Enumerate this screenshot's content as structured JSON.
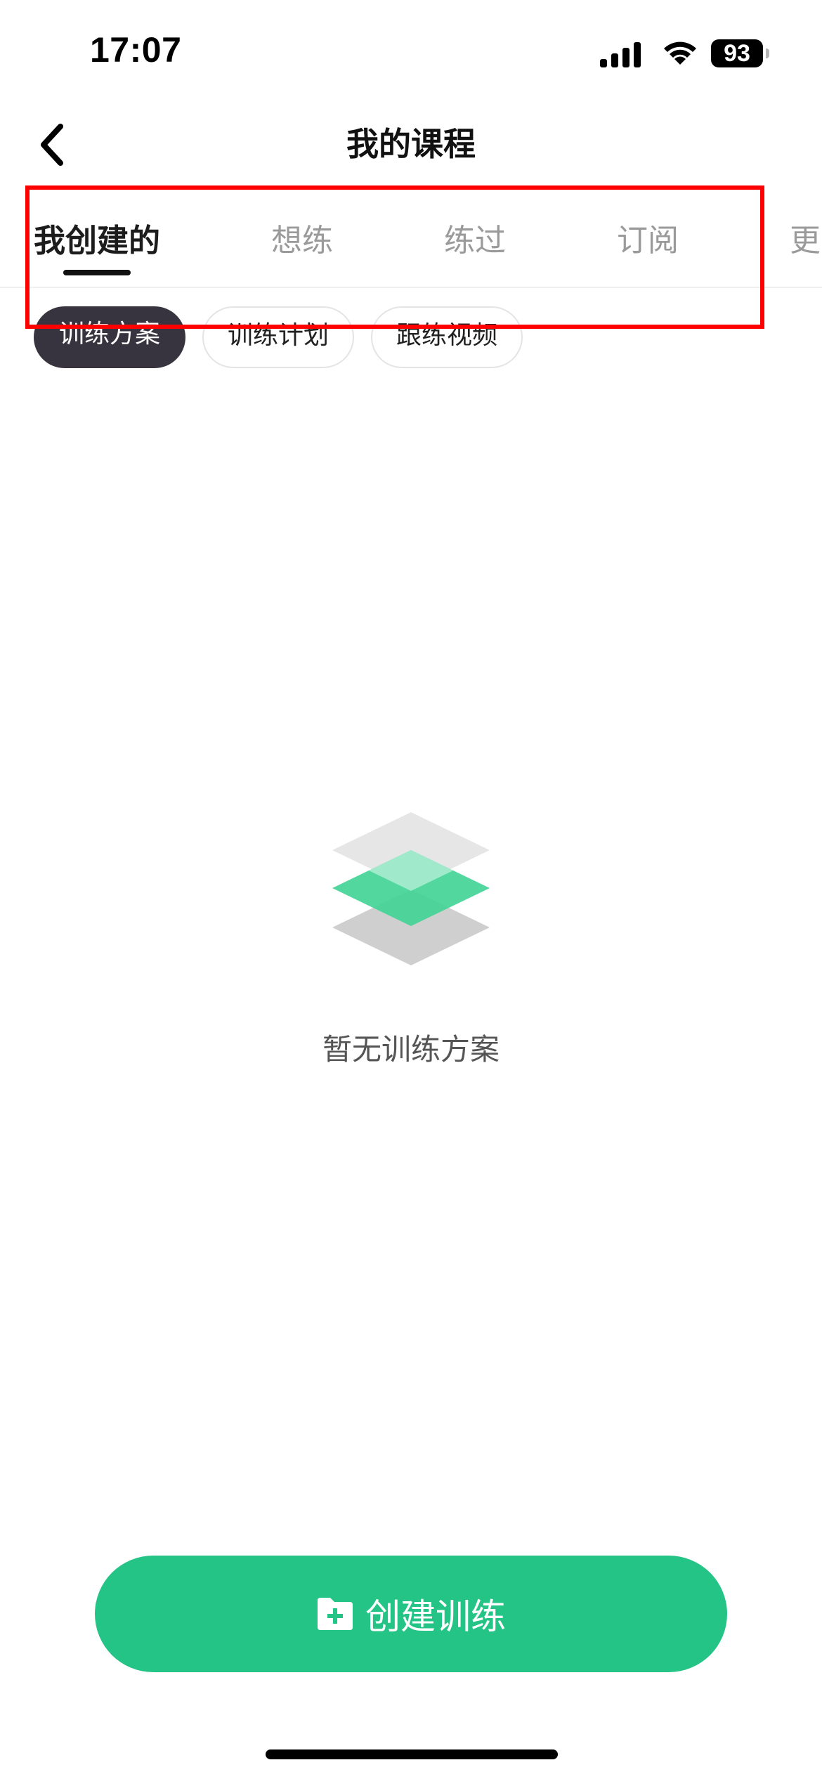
{
  "status_bar": {
    "time": "17:07",
    "battery_level": "93",
    "icons": [
      "cellular-signal-icon",
      "wifi-icon",
      "battery-icon"
    ]
  },
  "header": {
    "title": "我的课程",
    "back_icon": "chevron-left-icon"
  },
  "tabs": [
    {
      "label": "我创建的",
      "active": true
    },
    {
      "label": "想练",
      "active": false
    },
    {
      "label": "练过",
      "active": false
    },
    {
      "label": "订阅",
      "active": false
    },
    {
      "label": "更",
      "active": false
    }
  ],
  "sub_tabs": [
    {
      "label": "训练方案",
      "active": true
    },
    {
      "label": "训练计划",
      "active": false
    },
    {
      "label": "跟练视频",
      "active": false
    }
  ],
  "empty_state": {
    "icon": "stacked-layers-icon",
    "message": "暂无训练方案"
  },
  "primary_action": {
    "label": "创建训练",
    "icon": "add-file-icon"
  },
  "colors": {
    "accent": "#24c486",
    "chip_active_bg": "#37343f",
    "highlight": "#ff0000"
  }
}
